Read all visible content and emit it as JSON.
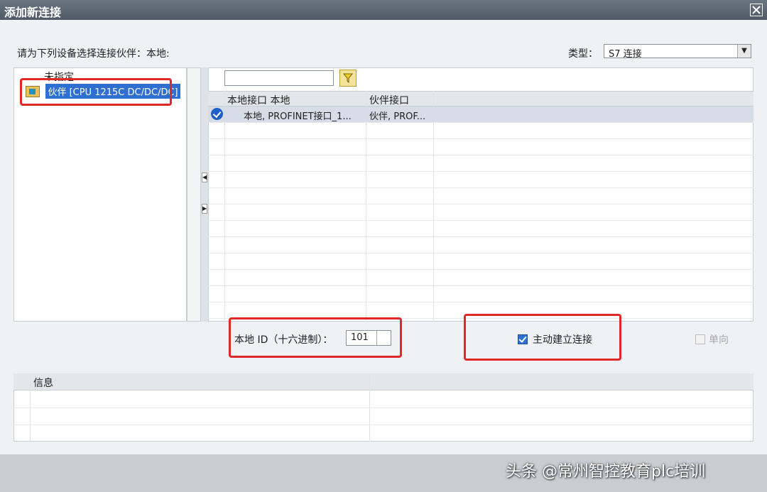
{
  "dialog": {
    "title": "添加新连接"
  },
  "prompt": "请为下列设备选择连接伙伴：本地:",
  "type": {
    "label": "类型：",
    "value": "S7 连接"
  },
  "tree": {
    "items": [
      {
        "label": "未指定"
      },
      {
        "label": "伙伴 [CPU 1215C DC/DC/DC]",
        "selected": true
      }
    ]
  },
  "grid": {
    "columns": [
      "本地接口 本地",
      "伙伴接口"
    ],
    "rows": [
      {
        "local": "本地, PROFINET接口_1...",
        "partner": "伙伴, PROF...",
        "selected": true
      }
    ]
  },
  "local_id": {
    "label": "本地 ID（十六进制）：",
    "value": "101"
  },
  "options": {
    "active_connect": {
      "label": "主动建立连接",
      "checked": true
    },
    "one_way": {
      "label": "单向",
      "checked": false,
      "enabled": false
    }
  },
  "info": {
    "header": "信息"
  },
  "watermark": "头条 @常州智控教育plc培训",
  "colors": {
    "highlight_box": "#e0282a",
    "selection": "#2f6fd0"
  }
}
